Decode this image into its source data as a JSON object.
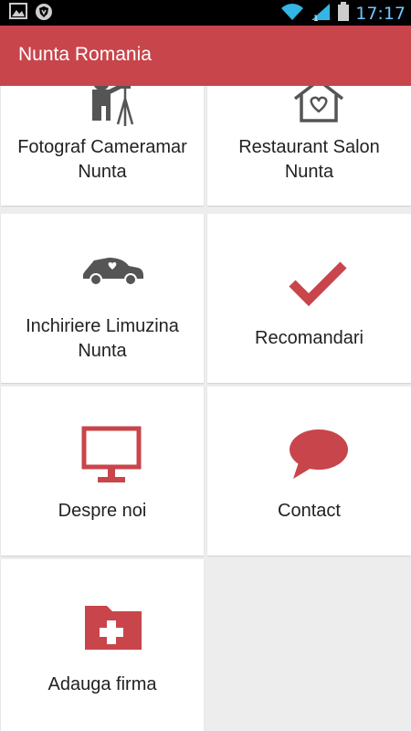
{
  "statusbar": {
    "time": "17:17",
    "icons": [
      "gallery-icon",
      "shield-icon",
      "wifi-icon",
      "signal-icon",
      "battery-icon"
    ]
  },
  "appbar": {
    "title": "Nunta Romania"
  },
  "tiles": [
    {
      "label_line1": "Fotograf Cameramar",
      "label_line2": "Nunta",
      "icon": "photographer-icon"
    },
    {
      "label_line1": "Restaurant Salon",
      "label_line2": "Nunta",
      "icon": "house-heart-icon"
    },
    {
      "label_line1": "Inchiriere Limuzina",
      "label_line2": "Nunta",
      "icon": "wedding-car-icon"
    },
    {
      "label_line1": "Recomandari",
      "icon": "checkmark-icon"
    },
    {
      "label_line1": "Despre noi",
      "icon": "monitor-icon"
    },
    {
      "label_line1": "Contact",
      "icon": "speech-bubble-icon"
    },
    {
      "label_line1": "Adauga firma",
      "icon": "add-folder-icon"
    }
  ],
  "colors": {
    "accent": "#c8454b",
    "icon_gray": "#555555",
    "background": "#ededed"
  }
}
